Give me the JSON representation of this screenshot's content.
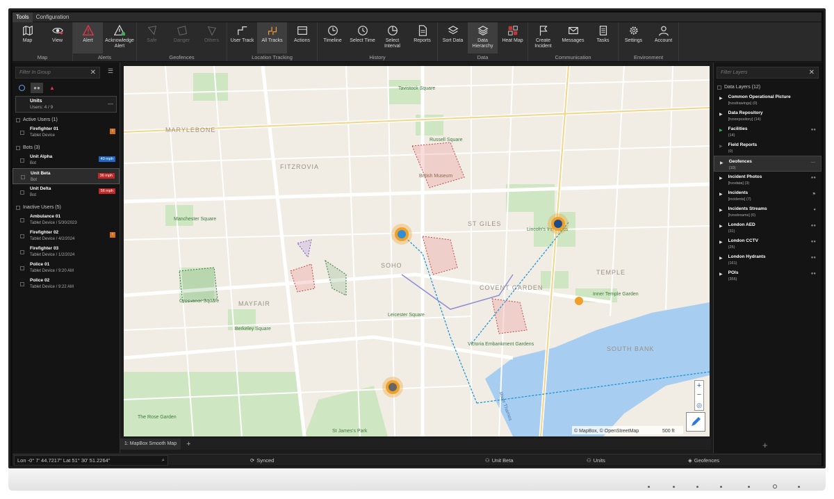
{
  "menubar": {
    "tabs": [
      "Tools",
      "Configuration"
    ]
  },
  "ribbon": {
    "groups": [
      {
        "label": "Map",
        "buttons": [
          {
            "label": "Map"
          },
          {
            "label": "View"
          }
        ]
      },
      {
        "label": "Alerts",
        "buttons": [
          {
            "label": "Alert"
          },
          {
            "label": "Acknowledge Alert"
          }
        ]
      },
      {
        "label": "Geofences",
        "buttons": [
          {
            "label": "Safe"
          },
          {
            "label": "Danger"
          },
          {
            "label": "Others"
          }
        ]
      },
      {
        "label": "Location Tracking",
        "buttons": [
          {
            "label": "User Track"
          },
          {
            "label": "All Tracks"
          },
          {
            "label": "Actions"
          }
        ]
      },
      {
        "label": "History",
        "buttons": [
          {
            "label": "Timeline"
          },
          {
            "label": "Select Time"
          },
          {
            "label": "Select Interval"
          },
          {
            "label": "Reports"
          }
        ]
      },
      {
        "label": "Data",
        "buttons": [
          {
            "label": "Sort Data"
          },
          {
            "label": "Data Hierarchy"
          },
          {
            "label": "Heat Map"
          }
        ]
      },
      {
        "label": "Communication",
        "buttons": [
          {
            "label": "Create Incident"
          },
          {
            "label": "Messages"
          },
          {
            "label": "Tasks"
          }
        ]
      },
      {
        "label": "Environment",
        "buttons": [
          {
            "label": "Settings"
          },
          {
            "label": "Account"
          }
        ]
      }
    ]
  },
  "left_panel": {
    "filter_placeholder": "Filter In Group",
    "units_title": "Units",
    "units_sub": "Users: 4 / 9",
    "sections": [
      {
        "title": "Active Users (1)",
        "items": [
          {
            "name": "Firefighter 01",
            "sub": "Tablet Device",
            "badge": "!",
            "badge_type": "warn"
          }
        ]
      },
      {
        "title": "Bots (3)",
        "items": [
          {
            "name": "Unit Alpha",
            "sub": "Bot",
            "badge": "40 mph",
            "badge_type": "blue"
          },
          {
            "name": "Unit Beta",
            "sub": "Bot",
            "badge": "36 mph",
            "badge_type": "red"
          },
          {
            "name": "Unit Delta",
            "sub": "Bot",
            "badge": "56 mph",
            "badge_type": "red"
          }
        ]
      },
      {
        "title": "Inactive Users (5)",
        "items": [
          {
            "name": "Ambulance 01",
            "sub": "Tablet Device / 5/30/2023",
            "badge": "",
            "badge_type": ""
          },
          {
            "name": "Firefighter 02",
            "sub": "Tablet Device / 4/2/2024",
            "badge": "!",
            "badge_type": "warn"
          },
          {
            "name": "Firefighter 03",
            "sub": "Tablet Device / 1/2/2024",
            "badge": "",
            "badge_type": ""
          },
          {
            "name": "Police 01",
            "sub": "Tablet Device / 9:20 AM",
            "badge": "",
            "badge_type": ""
          },
          {
            "name": "Police 02",
            "sub": "Tablet Device / 9:22 AM",
            "badge": "",
            "badge_type": ""
          }
        ]
      }
    ]
  },
  "map": {
    "tab_label": "1: MapBox Smooth Map",
    "attribution": "© MapBox, © OpenStreetMap",
    "scale": "500 ft",
    "labels": {
      "marylebone": "MARYLEBONE",
      "fitzrovia": "FITZROVIA",
      "mayfair": "MAYFAIR",
      "soho": "SOHO",
      "st_giles": "ST GILES",
      "covent_garden": "COVENT GARDEN",
      "temple": "TEMPLE",
      "tavistock": "Tavistock Square",
      "russell": "Russell Square",
      "manchester": "Manchester Square",
      "grosvenor": "Grosvenor Square",
      "berkeley": "Berkeley Square",
      "leicester": "Leicester Square",
      "lincoln": "Lincoln's Inn Fields",
      "inner_temple": "Inner Temple Garden",
      "victoria_emb": "Victoria Embankment Gardens",
      "rose_garden": "The Rose Garden",
      "st_james": "St James's Park",
      "british_museum": "British Museum",
      "thames": "River Thames",
      "southbank": "SOUTH BANK"
    }
  },
  "right_panel": {
    "filter_placeholder": "Filter Layers",
    "header": "Data Layers (12)",
    "layers": [
      {
        "name": "Common Operational Picture",
        "sub": "[hzsdrawings] (0)"
      },
      {
        "name": "Data Repository",
        "sub": "[hzsrepository] (14)"
      },
      {
        "name": "Facilities",
        "sub": "(14)"
      },
      {
        "name": "Field Reports",
        "sub": "(0)"
      },
      {
        "name": "Geofences",
        "sub": "(10)"
      },
      {
        "name": "Incident Photos",
        "sub": "[hzsdata] (3)"
      },
      {
        "name": "Incidents",
        "sub": "[incidents] (7)"
      },
      {
        "name": "Incidents Streams",
        "sub": "[hzsstreams] (0)"
      },
      {
        "name": "London AED",
        "sub": "(31)"
      },
      {
        "name": "London CCTV",
        "sub": "(25)"
      },
      {
        "name": "London Hydrants",
        "sub": "(161)"
      },
      {
        "name": "POIs",
        "sub": "(356)"
      }
    ]
  },
  "status": {
    "coords": "Lon -0° 7' 44.7217\"  Lat 51° 30' 51.2264\"",
    "synced": "Synced",
    "unit": "Unit Beta",
    "units": "Units",
    "geofences": "Geofences"
  }
}
